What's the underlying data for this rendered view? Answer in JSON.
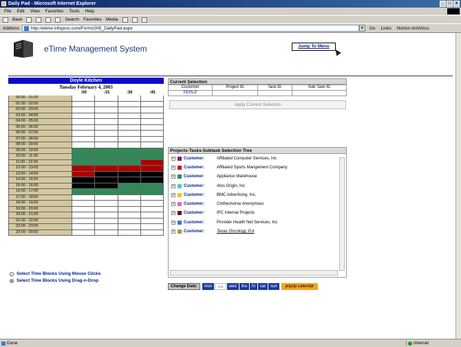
{
  "window": {
    "title": "Daily Pad - Microsoft Internet Explorer"
  },
  "menu": [
    "File",
    "Edit",
    "View",
    "Favorites",
    "Tools",
    "Help"
  ],
  "toolbar": {
    "back": "Back",
    "search": "Search",
    "favorites": "Favorites",
    "media": "Media"
  },
  "address": {
    "label": "Address",
    "url": "http://etime.infoproc.com/Form1005_DailyPad.aspx",
    "go": "Go",
    "links": "Links",
    "norton": "Norton AntiVirus"
  },
  "app": {
    "title": "eTime Management System",
    "jump": "Jump To Menu"
  },
  "schedule": {
    "name": "Doyle Kitchen",
    "date": "Tuesday February 4, 2003",
    "minutes": [
      ":00",
      ":15",
      ":30",
      ":45"
    ],
    "rows": [
      {
        "label": "00:00 - 01:00",
        "cells": [
          "",
          "",
          "",
          ""
        ]
      },
      {
        "label": "01:00 - 02:00",
        "cells": [
          "",
          "",
          "",
          ""
        ]
      },
      {
        "label": "02:00 - 03:00",
        "cells": [
          "",
          "",
          "",
          ""
        ]
      },
      {
        "label": "03:00 - 04:00",
        "cells": [
          "",
          "",
          "",
          ""
        ]
      },
      {
        "label": "04:00 - 05:00",
        "cells": [
          "",
          "",
          "",
          ""
        ]
      },
      {
        "label": "05:00 - 06:00",
        "cells": [
          "",
          "",
          "",
          ""
        ]
      },
      {
        "label": "06:00 - 07:00",
        "cells": [
          "",
          "",
          "",
          ""
        ]
      },
      {
        "label": "07:00 - 08:00",
        "cells": [
          "",
          "",
          "",
          ""
        ]
      },
      {
        "label": "08:00 - 09:00",
        "cells": [
          "",
          "",
          "",
          ""
        ]
      },
      {
        "label": "09:00 - 10:00",
        "cells": [
          "#2e8b57",
          "#2e8b57",
          "#2e8b57",
          "#2e8b57"
        ]
      },
      {
        "label": "10:00 - 11:00",
        "cells": [
          "#2e8b57",
          "#2e8b57",
          "#2e8b57",
          "#2e8b57"
        ]
      },
      {
        "label": "11:00 - 12:00",
        "cells": [
          "#2e8b57",
          "#2e8b57",
          "#2e8b57",
          "#b00000"
        ]
      },
      {
        "label": "12:00 - 13:00",
        "cells": [
          "#b00000",
          "#b00000",
          "#b00000",
          "#b00000"
        ]
      },
      {
        "label": "13:00 - 14:00",
        "cells": [
          "#b00000",
          "#000000",
          "#000000",
          "#000000"
        ]
      },
      {
        "label": "14:00 - 15:00",
        "cells": [
          "#000000",
          "#000000",
          "#000000",
          "#000000"
        ]
      },
      {
        "label": "15:00 - 16:00",
        "cells": [
          "#000000",
          "#000000",
          "#2e8b57",
          "#2e8b57"
        ]
      },
      {
        "label": "16:00 - 17:00",
        "cells": [
          "#2e8b57",
          "#2e8b57",
          "#2e8b57",
          "#2e8b57"
        ]
      },
      {
        "label": "17:00 - 18:00",
        "cells": [
          "",
          "",
          "",
          ""
        ]
      },
      {
        "label": "18:00 - 19:00",
        "cells": [
          "",
          "",
          "",
          ""
        ]
      },
      {
        "label": "19:00 - 20:00",
        "cells": [
          "",
          "",
          "",
          ""
        ]
      },
      {
        "label": "20:00 - 21:00",
        "cells": [
          "",
          "",
          "",
          ""
        ]
      },
      {
        "label": "21:00 - 22:00",
        "cells": [
          "",
          "",
          "",
          ""
        ]
      },
      {
        "label": "22:00 - 23:00",
        "cells": [
          "",
          "",
          "",
          ""
        ]
      },
      {
        "label": "23:00 - 00:00",
        "cells": [
          "",
          "",
          "",
          ""
        ]
      }
    ]
  },
  "options": {
    "mouse": "Select Time Blocks Using Mouse Clicks",
    "drag": "Select Time Blocks Using Drag-n-Drop"
  },
  "selection": {
    "title": "Current Selection",
    "headers": [
      "Customer",
      "Project ID",
      "Task ID",
      "Sub Task ID"
    ],
    "values": [
      "PERLP",
      "",
      "",
      ""
    ],
    "apply": "Apply Current Selection"
  },
  "tree": {
    "title": "Projects-Tasks-Subtask Selection Tree",
    "label": "Customer:",
    "items": [
      {
        "name": "Affiliated Computer Services, Inc",
        "color": "#8b1a6b"
      },
      {
        "name": "Affiliated Sports Mangement Company",
        "color": "#d01010"
      },
      {
        "name": "Appliance Warehouse",
        "color": "#2e8b57"
      },
      {
        "name": "Atos Origin, Inc",
        "color": "#48c8d8"
      },
      {
        "name": "BMC Advertising, Inc.",
        "color": "#e8c820"
      },
      {
        "name": "Clotheshorse Anonymous",
        "color": "#e070b0"
      },
      {
        "name": "IPC Internal Projects",
        "color": "#6a0a1a"
      },
      {
        "name": "Provider Health Net Services, Inc",
        "color": "#3a7bd5"
      },
      {
        "name": "Texas Oncology, P.A",
        "color": "#a09a50"
      }
    ]
  },
  "changedate": {
    "label": "Change Date:",
    "days": [
      "mon",
      "tue",
      "wed",
      "thu",
      "fri",
      "sat",
      "sun"
    ],
    "selected": "tue",
    "popup": "popup calendar"
  },
  "status": {
    "text": "Done",
    "zone": "Internet"
  }
}
